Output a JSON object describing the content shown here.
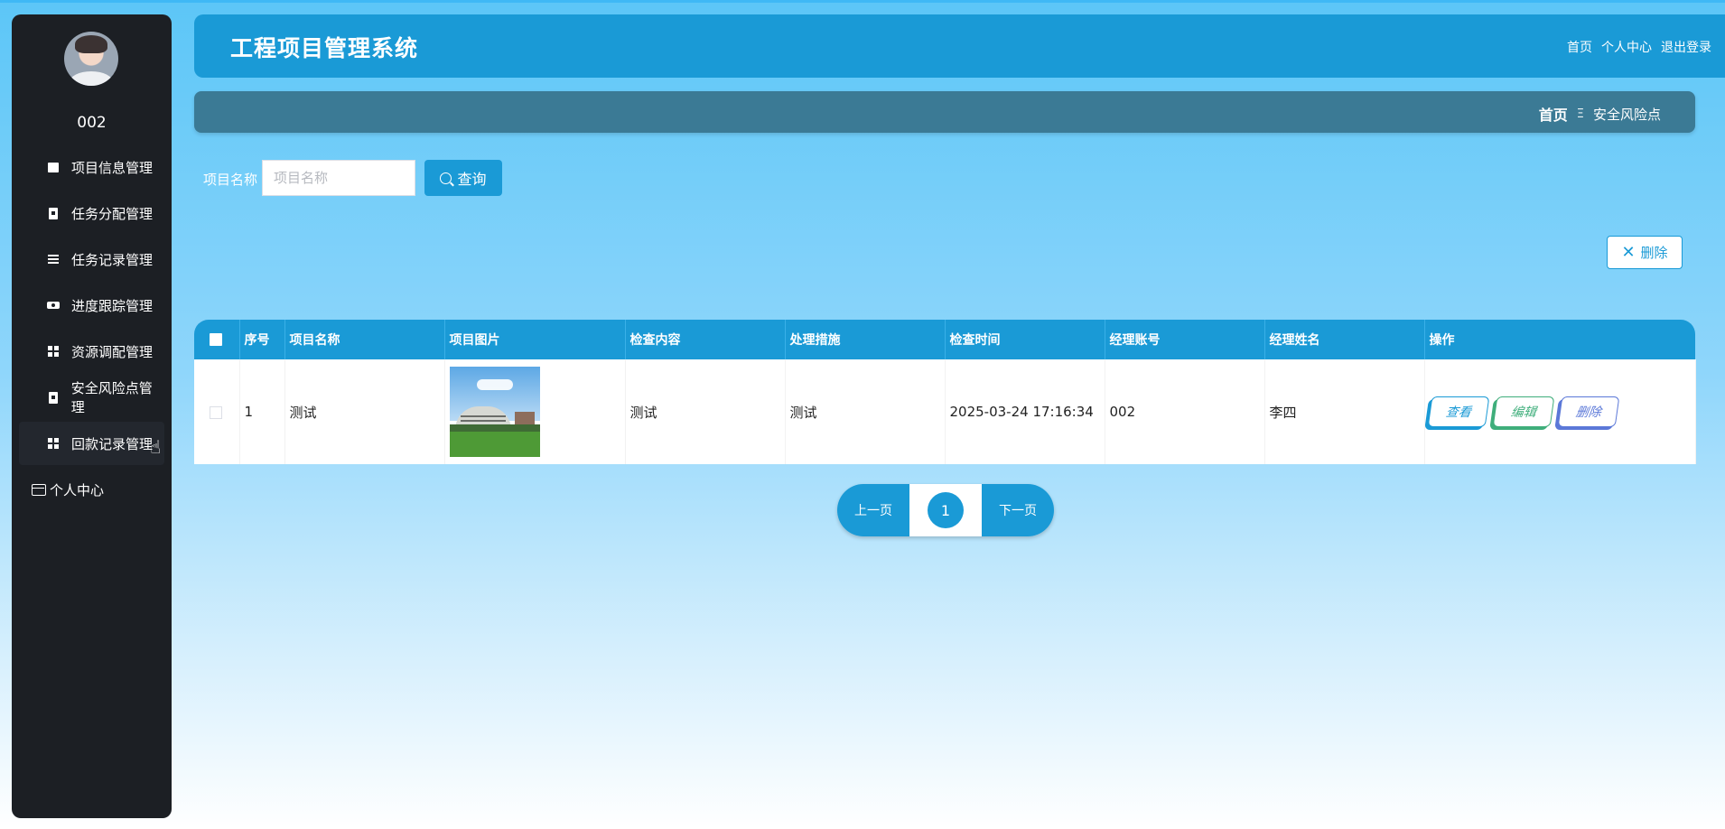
{
  "app_title": "工程项目管理系统",
  "top_nav": {
    "home": "首页",
    "profile": "个人中心",
    "logout": "退出登录"
  },
  "user": {
    "name": "002"
  },
  "sidebar": {
    "items": [
      {
        "label": "项目信息管理",
        "icon": "briefcase-icon"
      },
      {
        "label": "任务分配管理",
        "icon": "clipboard-icon"
      },
      {
        "label": "任务记录管理",
        "icon": "list-icon"
      },
      {
        "label": "进度跟踪管理",
        "icon": "ticket-icon"
      },
      {
        "label": "资源调配管理",
        "icon": "grid-icon"
      },
      {
        "label": "安全风险点管理",
        "icon": "clipboard-icon"
      },
      {
        "label": "回款记录管理",
        "icon": "grid-icon"
      }
    ],
    "personal": {
      "label": "个人中心",
      "icon": "card-icon"
    }
  },
  "breadcrumb": {
    "home": "首页",
    "separator": "Ξ",
    "current": "安全风险点"
  },
  "search": {
    "label": "项目名称",
    "placeholder": "项目名称",
    "button": "查询"
  },
  "delete_button": "删除",
  "table": {
    "columns": [
      "序号",
      "项目名称",
      "项目图片",
      "检查内容",
      "处理措施",
      "检查时间",
      "经理账号",
      "经理姓名",
      "操作"
    ],
    "rows": [
      {
        "index": "1",
        "project_name": "测试",
        "image": "building-photo",
        "check_content": "测试",
        "measures": "测试",
        "check_time": "2025-03-24 17:16:34",
        "manager_account": "002",
        "manager_name": "李四",
        "actions": {
          "view": "查看",
          "edit": "编辑",
          "delete": "删除"
        }
      }
    ]
  },
  "pagination": {
    "prev": "上一页",
    "current_page": "1",
    "next": "下一页"
  },
  "colors": {
    "primary": "#1a9ad6",
    "sidebar": "#1c1f24",
    "breadcrumb_bar": "#3b7a95",
    "edit": "#3fae7b",
    "delete": "#5b78d8"
  }
}
